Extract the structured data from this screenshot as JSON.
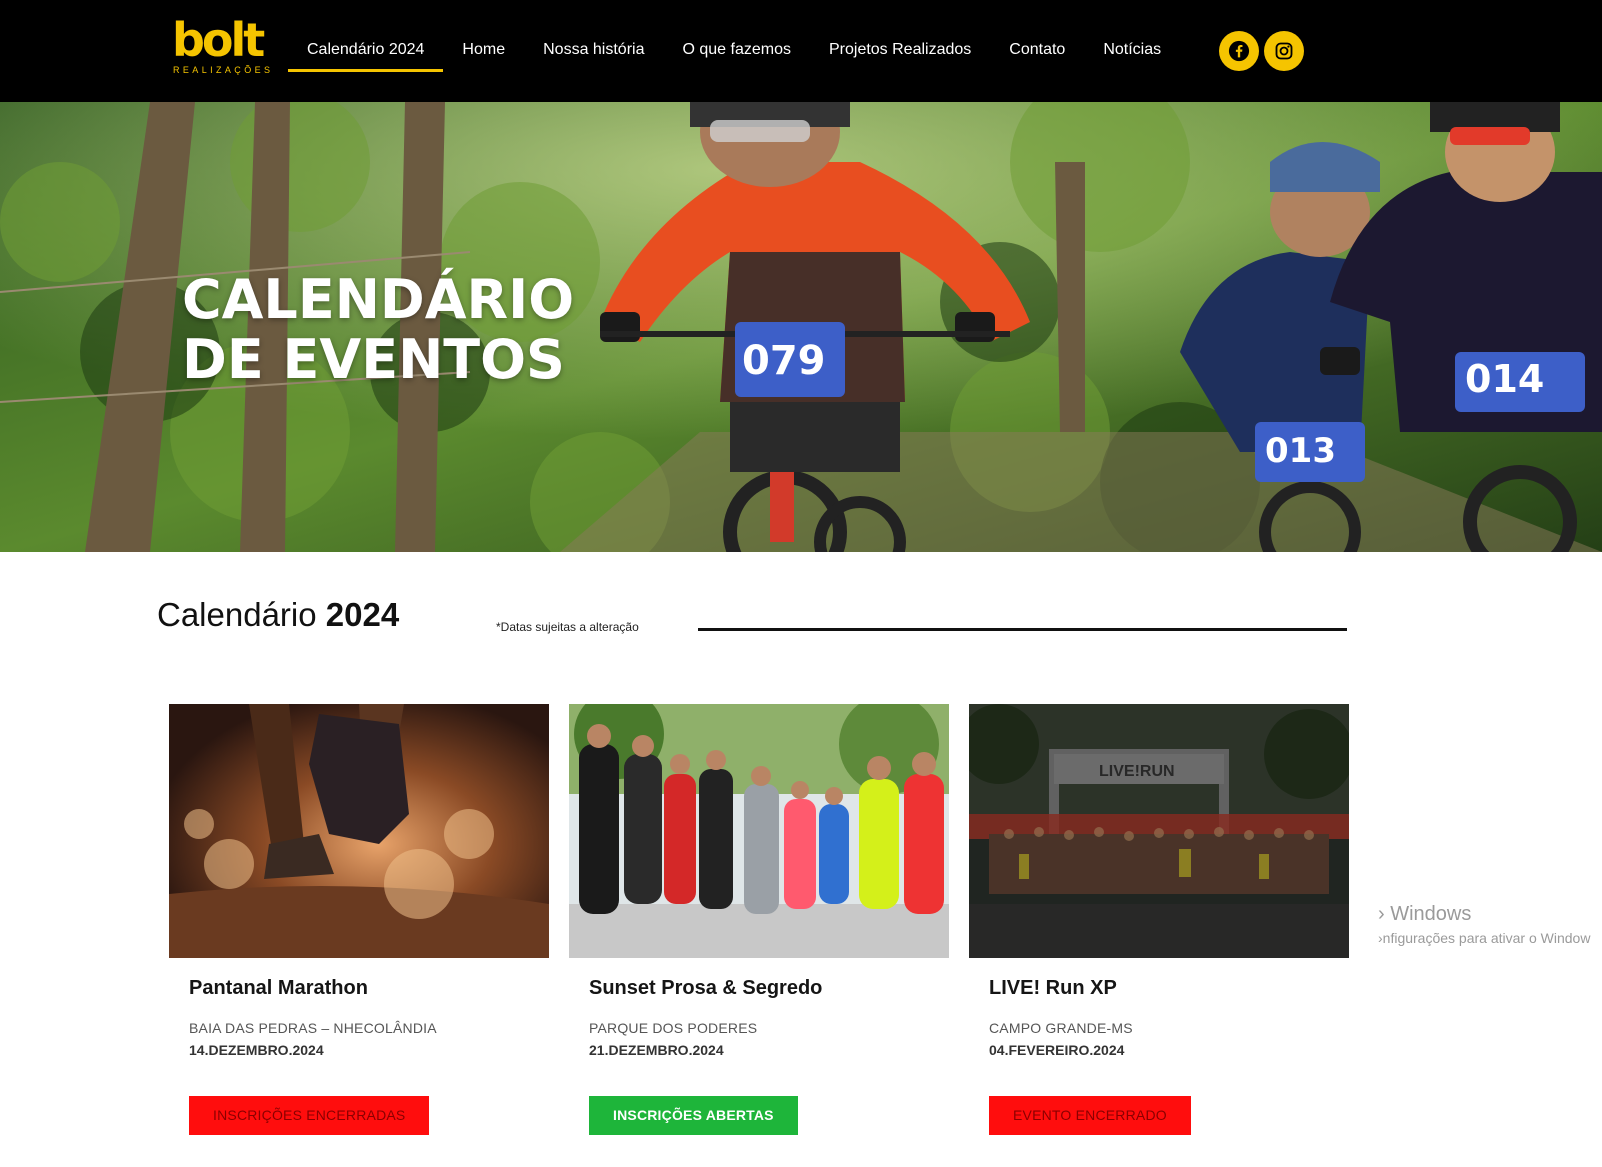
{
  "brand": {
    "logo_text": "bolt",
    "logo_sub": "REALIZAÇÕES",
    "accent": "#f5c400"
  },
  "nav": {
    "items": [
      {
        "label": "Calendário 2024",
        "active": true
      },
      {
        "label": "Home"
      },
      {
        "label": "Nossa história"
      },
      {
        "label": "O que fazemos"
      },
      {
        "label": "Projetos Realizados"
      },
      {
        "label": "Contato"
      },
      {
        "label": "Notícias"
      }
    ],
    "social": [
      {
        "icon": "facebook-icon"
      },
      {
        "icon": "instagram-icon"
      }
    ]
  },
  "hero": {
    "title_line1": "CALENDÁRIO",
    "title_line2": "DE EVENTOS",
    "bib_numbers": [
      "079",
      "013",
      "014"
    ]
  },
  "section": {
    "title_light": "Calendário",
    "title_bold": "2024",
    "note": "*Datas sujeitas a alteração"
  },
  "events": [
    {
      "title": "Pantanal Marathon",
      "place": "BAIA DAS PEDRAS – NHECOLÂNDIA",
      "date": "14.DEZEMBRO.2024",
      "button": "INSCRIÇÕES ENCERRADAS",
      "status": "closed",
      "button_color": "#ff0d0d"
    },
    {
      "title": "Sunset Prosa & Segredo",
      "place": "PARQUE DOS PODERES",
      "date": "21.DEZEMBRO.2024",
      "button": "INSCRIÇÕES ABERTAS",
      "status": "open",
      "button_color": "#1eb53a"
    },
    {
      "title": "LIVE! Run XP",
      "place": "CAMPO GRANDE-MS",
      "date": "04.FEVEREIRO.2024",
      "button": "EVENTO ENCERRADO",
      "status": "ended",
      "button_color": "#ff0d0d",
      "arch_text": "LIVE!RUN"
    }
  ],
  "watermark": {
    "line1": "› Windows",
    "line2": "›nfigurações para ativar o Window"
  }
}
